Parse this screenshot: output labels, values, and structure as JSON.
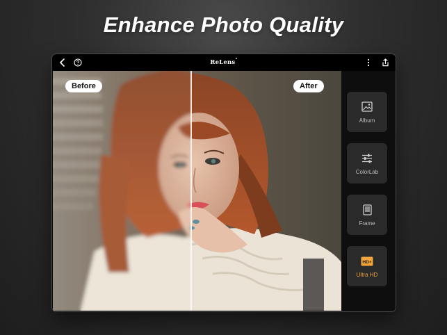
{
  "headline": "Enhance Photo Quality",
  "app": {
    "brand": "ReLens",
    "brand_mark": "°"
  },
  "topbar": {
    "back_icon": "chevron-left-icon",
    "help_icon": "help-circle-icon",
    "more_icon": "more-vertical-icon",
    "share_icon": "share-icon"
  },
  "compare": {
    "before_label": "Before",
    "after_label": "After"
  },
  "tools": [
    {
      "label": "Album",
      "icon": "image-icon",
      "active": false
    },
    {
      "label": "ColorLab",
      "icon": "sliders-icon",
      "active": false
    },
    {
      "label": "Frame",
      "icon": "frame-icon",
      "active": false
    },
    {
      "label": "Ultra HD",
      "icon": "hd-plus-icon",
      "active": true,
      "badge": "HD+"
    }
  ],
  "colors": {
    "accent": "#f0a63a",
    "tool_bg": "#2a2a2a",
    "panel_bg": "#0e0e0e",
    "background": "#2e2e2e"
  }
}
